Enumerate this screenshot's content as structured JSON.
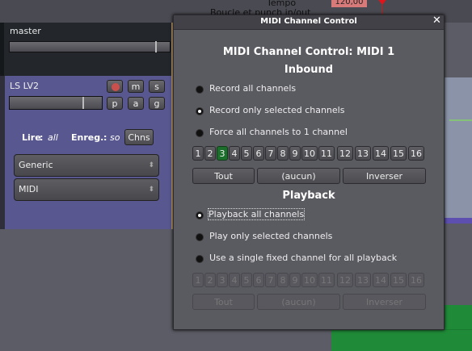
{
  "editor": {
    "tempo_label": "Tempo",
    "tempo_value": "120,00",
    "loop_label": "Boucle et punch in/out"
  },
  "mixer": {
    "master_name": "master",
    "track_name": "LS LV2",
    "buttons": [
      "m",
      "s",
      "p",
      "a",
      "g"
    ],
    "lire_label": "Lire",
    "lire_value": "all",
    "enreg_label": "Enreg.",
    "enreg_value": "so",
    "chns_label": "Chns",
    "dropdown1": "Generic",
    "dropdown2": "MIDI"
  },
  "dialog": {
    "title": "MIDI Channel Control",
    "heading": "MIDI Channel Control: MIDI 1",
    "inbound": {
      "label": "Inbound",
      "options": [
        "Record all channels",
        "Record only selected channels",
        "Force all channels to 1 channel"
      ],
      "selected_index": 1,
      "channels": [
        "1",
        "2",
        "3",
        "4",
        "5",
        "6",
        "7",
        "8",
        "9",
        "10",
        "11",
        "12",
        "13",
        "14",
        "15",
        "16"
      ],
      "selected_channel": "3",
      "actions": [
        "Tout",
        "(aucun)",
        "Inverser"
      ]
    },
    "playback": {
      "label": "Playback",
      "options": [
        "Playback all channels",
        "Play only selected channels",
        "Use a single fixed channel for all playback"
      ],
      "selected_index": 0,
      "channels": [
        "1",
        "2",
        "3",
        "4",
        "5",
        "6",
        "7",
        "8",
        "9",
        "10",
        "11",
        "12",
        "13",
        "14",
        "15",
        "16"
      ],
      "actions": [
        "Tout",
        "(aucun)",
        "Inverser"
      ]
    }
  }
}
